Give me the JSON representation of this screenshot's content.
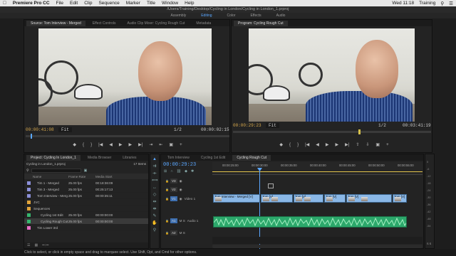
{
  "menubar": {
    "app": "Premiere Pro CC",
    "items": [
      "File",
      "Edit",
      "Clip",
      "Sequence",
      "Marker",
      "Title",
      "Window",
      "Help"
    ],
    "clock": "Wed 11:18",
    "user": "Training"
  },
  "title": "/Users/Training/Desktop/Cycling in London/Cycling in London_1.prproj",
  "workspaces": [
    {
      "label": "Assembly",
      "active": false
    },
    {
      "label": "Editing",
      "active": true
    },
    {
      "label": "Color",
      "active": false
    },
    {
      "label": "Effects",
      "active": false
    },
    {
      "label": "Audio",
      "active": false
    }
  ],
  "source": {
    "tabs": [
      "Source: Tom Interview - Merged",
      "Effect Controls",
      "Audio Clip Mixer: Cycling Rough Cut",
      "Metadata"
    ],
    "timecode": "00:00:41:08",
    "fit": "Fit",
    "ratio": "1/2",
    "duration": "00:00:02:15"
  },
  "program": {
    "tab": "Program: Cycling Rough Cut",
    "timecode": "00:00:29:23",
    "fit": "Fit",
    "ratio": "1/2",
    "duration": "00:03:41:19"
  },
  "transport": {
    "buttons": [
      "◆",
      "{",
      "}",
      "|◀",
      "◀",
      "▶",
      "▶|",
      "⇥",
      "⇤",
      "+"
    ]
  },
  "project": {
    "tabs": [
      "Project: Cycling In London_1",
      "Media Browser",
      "Libraries"
    ],
    "file": "Cycling in London_1.prproj",
    "item_count": "17 Items",
    "columns": [
      "Name",
      "Frame Rate",
      "Media Start"
    ],
    "rows": [
      {
        "name": "Tim 1 - Merged",
        "rate": "25.00 fps",
        "start": "00:18:36:09",
        "color": "#8b8fd8",
        "indent": 1
      },
      {
        "name": "Tim 3 - Merged",
        "rate": "25.00 fps",
        "start": "00:25:17:13",
        "color": "#8b8fd8",
        "indent": 1
      },
      {
        "name": "Tom Interview - Merg",
        "rate": "25.00 fps",
        "start": "00:00:35:11",
        "color": "#8b8fd8",
        "indent": 1
      },
      {
        "name": "JVC",
        "rate": "",
        "start": "",
        "color": "#e0a33a",
        "indent": 0
      },
      {
        "name": "Sequences",
        "rate": "",
        "start": "",
        "color": "#e0a33a",
        "indent": 0
      },
      {
        "name": "Cycling 1st Edit",
        "rate": "25.00 fps",
        "start": "00:00:00:00",
        "color": "#36b56e",
        "indent": 2
      },
      {
        "name": "Cycling Rough Cut",
        "rate": "25.00 fps",
        "start": "00:00:00:00",
        "color": "#36b56e",
        "indent": 2
      },
      {
        "name": "Tim Lower 3rd",
        "rate": "",
        "start": "",
        "color": "#e76ec5",
        "indent": 1
      }
    ]
  },
  "timeline": {
    "tabs": [
      "Tom Interview",
      "Cycling 1st Edit",
      "Cycling Rough Cut"
    ],
    "timecode": "00:00:29:23",
    "ruler": [
      "00:00:25:00",
      "00:00:30:00",
      "00:00:35:00",
      "00:00:40:00",
      "00:00:45:00",
      "00:00:50:00",
      "00:00:55:00"
    ],
    "tracks": [
      "V3",
      "V2",
      "V1",
      "A1",
      "A2"
    ],
    "v1_label": "Video 1",
    "a1_label": "Audio 1",
    "clips": [
      "Tom Interview - Merged [V]",
      "Tom [V]",
      "Tom [V]",
      "Tom [V]",
      "Tom [V]",
      "Tom [V]"
    ]
  },
  "meter": [
    "0",
    "-6",
    "-12",
    "-18",
    "-24",
    "-30",
    "-36",
    "-42",
    "-48",
    "-54"
  ],
  "status": "Click to select, or click in empty space and drag to marquee select. Use Shift, Opt, and Cmd for other options."
}
